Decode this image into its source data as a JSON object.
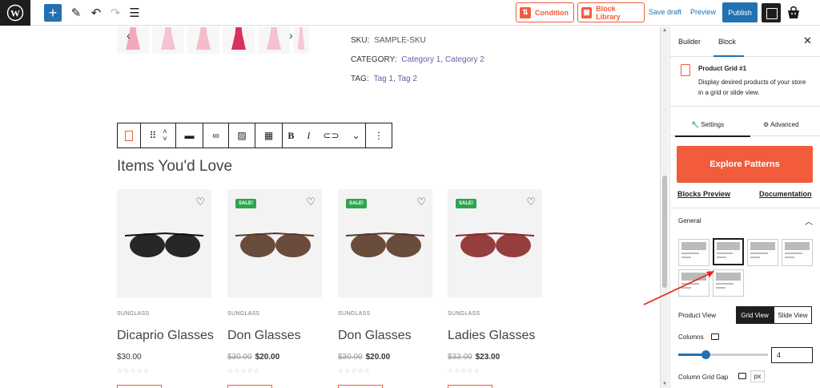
{
  "topbar": {
    "condition_label": "Condition",
    "block_library_label": "Block Library",
    "save_draft_label": "Save draft",
    "preview_label": "Preview",
    "publish_label": "Publish"
  },
  "product": {
    "sku_label": "SKU:",
    "sku_value": "SAMPLE-SKU",
    "category_label": "CATEGORY:",
    "category_1": "Category 1",
    "category_sep": ",",
    "category_2": "Category 2",
    "tag_label": "TAG:",
    "tag_1": "Tag 1",
    "tag_sep": ",",
    "tag_2": "Tag 2"
  },
  "section": {
    "title": "Items You'd Love"
  },
  "products": [
    {
      "category": "SUNGLASS",
      "name": "Dicaprio Glasses",
      "price": "$30.00",
      "old_price": "",
      "sale": "",
      "color": "#111111"
    },
    {
      "category": "SUNGLASS",
      "name": "Don Glasses",
      "price": "$20.00",
      "old_price": "$30.00",
      "sale": "SALE!",
      "color": "#5a3a28"
    },
    {
      "category": "SUNGLASS",
      "name": "Don Glasses",
      "price": "$20.00",
      "old_price": "$30.00",
      "sale": "SALE!",
      "color": "#5a3a28"
    },
    {
      "category": "SUNGLASS",
      "name": "Ladies Glasses",
      "price": "$23.00",
      "old_price": "$33.00",
      "sale": "SALE!",
      "color": "#8b2a2a"
    }
  ],
  "panel": {
    "tab_builder": "Builder",
    "tab_block": "Block",
    "block_name": "Product Grid #1",
    "block_desc": "Display desired products of your store in a grid or slide view.",
    "tab_settings": "Settings",
    "tab_advanced": "Advanced",
    "explore_label": "Explore Patterns",
    "blocks_preview": "Blocks Preview",
    "documentation": "Documentation",
    "general_label": "General",
    "product_view_label": "Product View",
    "grid_view": "Grid View",
    "slide_view": "Slide View",
    "columns_label": "Columns",
    "columns_value": "4",
    "columns_fraction": 0.3,
    "gap_label": "Column Grid Gap",
    "px_label": "px"
  },
  "colors": {
    "accent": "#f25c3b",
    "primary": "#2271b1",
    "sale_badge": "#2ea44f",
    "annotation_arrow": "#e8201c"
  }
}
